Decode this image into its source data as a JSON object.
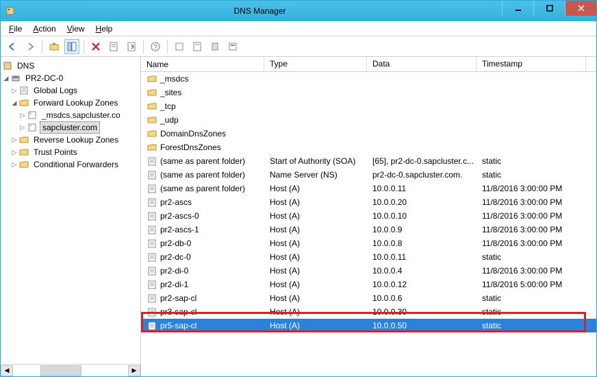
{
  "title": "DNS Manager",
  "menu": {
    "file": "File",
    "action": "Action",
    "view": "View",
    "help": "Help"
  },
  "tree": {
    "root": "DNS",
    "server": "PR2-DC-0",
    "nodes": {
      "global_logs": "Global Logs",
      "flz": "Forward Lookup Zones",
      "msdcs": "_msdcs.sapcluster.co",
      "sapcluster": "sapcluster.com",
      "rlz": "Reverse Lookup Zones",
      "tp": "Trust Points",
      "cf": "Conditional Forwarders"
    }
  },
  "columns": {
    "name": "Name",
    "type": "Type",
    "data": "Data",
    "timestamp": "Timestamp"
  },
  "rows": [
    {
      "icon": "folder",
      "name": "_msdcs",
      "type": "",
      "data": "",
      "ts": ""
    },
    {
      "icon": "folder",
      "name": "_sites",
      "type": "",
      "data": "",
      "ts": ""
    },
    {
      "icon": "folder",
      "name": "_tcp",
      "type": "",
      "data": "",
      "ts": ""
    },
    {
      "icon": "folder",
      "name": "_udp",
      "type": "",
      "data": "",
      "ts": ""
    },
    {
      "icon": "folder",
      "name": "DomainDnsZones",
      "type": "",
      "data": "",
      "ts": ""
    },
    {
      "icon": "folder",
      "name": "ForestDnsZones",
      "type": "",
      "data": "",
      "ts": ""
    },
    {
      "icon": "record",
      "name": "(same as parent folder)",
      "type": "Start of Authority (SOA)",
      "data": "[65], pr2-dc-0.sapcluster.c...",
      "ts": "static"
    },
    {
      "icon": "record",
      "name": "(same as parent folder)",
      "type": "Name Server (NS)",
      "data": "pr2-dc-0.sapcluster.com.",
      "ts": "static"
    },
    {
      "icon": "record",
      "name": "(same as parent folder)",
      "type": "Host (A)",
      "data": "10.0.0.11",
      "ts": "11/8/2016 3:00:00 PM"
    },
    {
      "icon": "record",
      "name": "pr2-ascs",
      "type": "Host (A)",
      "data": "10.0.0.20",
      "ts": "11/8/2016 3:00:00 PM"
    },
    {
      "icon": "record",
      "name": "pr2-ascs-0",
      "type": "Host (A)",
      "data": "10.0.0.10",
      "ts": "11/8/2016 3:00:00 PM"
    },
    {
      "icon": "record",
      "name": "pr2-ascs-1",
      "type": "Host (A)",
      "data": "10.0.0.9",
      "ts": "11/8/2016 3:00:00 PM"
    },
    {
      "icon": "record",
      "name": "pr2-db-0",
      "type": "Host (A)",
      "data": "10.0.0.8",
      "ts": "11/8/2016 3:00:00 PM"
    },
    {
      "icon": "record",
      "name": "pr2-dc-0",
      "type": "Host (A)",
      "data": "10.0.0.11",
      "ts": "static"
    },
    {
      "icon": "record",
      "name": "pr2-di-0",
      "type": "Host (A)",
      "data": "10.0.0.4",
      "ts": "11/8/2016 3:00:00 PM"
    },
    {
      "icon": "record",
      "name": "pr2-di-1",
      "type": "Host (A)",
      "data": "10.0.0.12",
      "ts": "11/8/2016 5:00:00 PM"
    },
    {
      "icon": "record",
      "name": "pr2-sap-cl",
      "type": "Host (A)",
      "data": "10.0.0.6",
      "ts": "static"
    },
    {
      "icon": "record",
      "name": "pr3-sap-cl",
      "type": "Host (A)",
      "data": "10.0.0.30",
      "ts": "static"
    },
    {
      "icon": "record",
      "name": "pr5-sap-cl",
      "type": "Host (A)",
      "data": "10.0.0.50",
      "ts": "static",
      "selected": true
    }
  ],
  "highlight_row_index": 18
}
